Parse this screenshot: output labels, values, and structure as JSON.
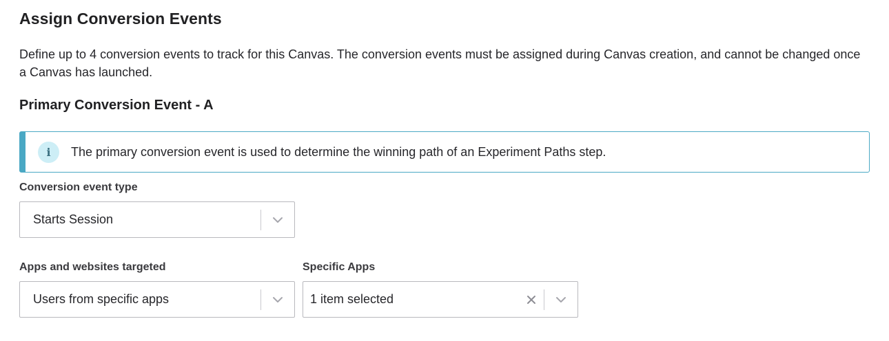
{
  "section": {
    "title": "Assign Conversion Events",
    "description": "Define up to 4 conversion events to track for this Canvas. The conversion events must be assigned during Canvas creation, and cannot be changed once a Canvas has launched."
  },
  "primary": {
    "title": "Primary Conversion Event - A",
    "info_text": "The primary conversion event is used to determine the winning path of an Experiment Paths step."
  },
  "fields": {
    "event_type": {
      "label": "Conversion event type",
      "value": "Starts Session"
    },
    "apps_targeted": {
      "label": "Apps and websites targeted",
      "value": "Users from specific apps"
    },
    "specific_apps": {
      "label": "Specific Apps",
      "value": "1 item selected"
    }
  },
  "icons": {
    "info": "info-icon",
    "chevron": "chevron-down-icon",
    "clear": "clear-x-icon"
  },
  "colors": {
    "accent": "#4aa8c4",
    "info_icon_bg": "#cdeef6"
  }
}
